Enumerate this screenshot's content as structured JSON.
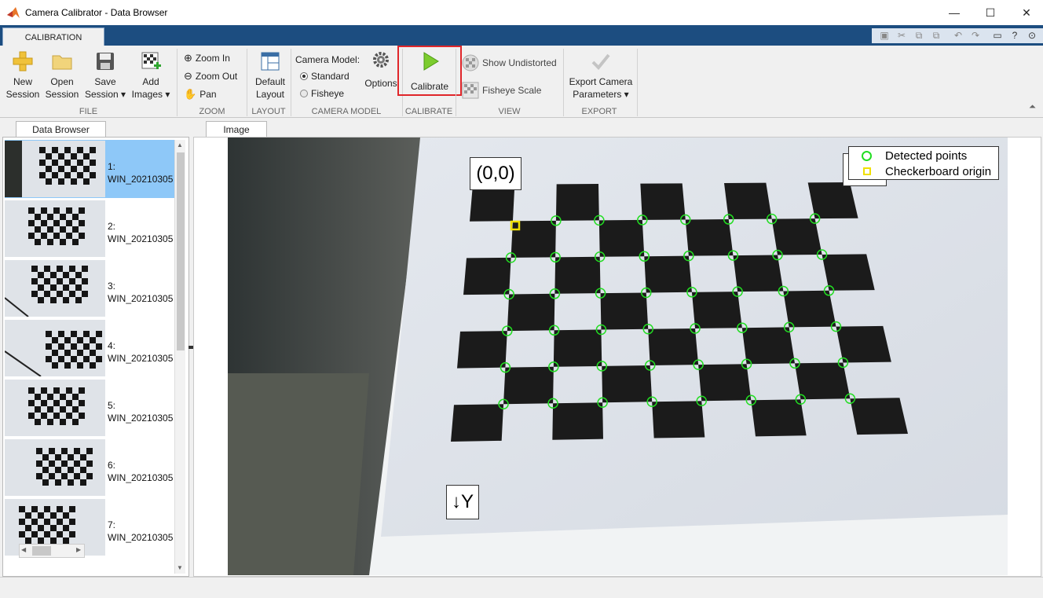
{
  "window": {
    "title": "Camera Calibrator - Data Browser",
    "minimize": "—",
    "maximize": "☐",
    "close": "✕"
  },
  "ribbon": {
    "tab": "CALIBRATION",
    "groups": {
      "file": "FILE",
      "zoom": "ZOOM",
      "layout": "LAYOUT",
      "camera_model": "CAMERA MODEL",
      "calibrate": "CALIBRATE",
      "view": "VIEW",
      "export": "EXPORT"
    },
    "new_session": [
      "New",
      "Session"
    ],
    "open_session": [
      "Open",
      "Session"
    ],
    "save_session": [
      "Save",
      "Session ▾"
    ],
    "add_images": [
      "Add",
      "Images ▾"
    ],
    "zoom_in": "Zoom In",
    "zoom_out": "Zoom Out",
    "pan": "Pan",
    "default_layout": [
      "Default",
      "Layout"
    ],
    "camera_model_label": "Camera Model:",
    "standard": "Standard",
    "fisheye": "Fisheye",
    "options": "Options",
    "calibrate_btn": "Calibrate",
    "show_undistorted": "Show Undistorted",
    "fisheye_scale": "Fisheye Scale",
    "export_camera": [
      "Export Camera",
      "Parameters ▾"
    ],
    "accent_color": "#1c4d80",
    "highlight_color": "#e0262a"
  },
  "data_browser": {
    "tab": "Data Browser",
    "items": [
      {
        "index": "1:",
        "name": "WIN_20210305",
        "selected": true
      },
      {
        "index": "2:",
        "name": "WIN_20210305",
        "selected": false
      },
      {
        "index": "3:",
        "name": "WIN_20210305",
        "selected": false
      },
      {
        "index": "4:",
        "name": "WIN_20210305",
        "selected": false
      },
      {
        "index": "5:",
        "name": "WIN_20210305",
        "selected": false
      },
      {
        "index": "6:",
        "name": "WIN_20210305",
        "selected": false
      },
      {
        "index": "7:",
        "name": "WIN_20210305",
        "selected": false
      }
    ]
  },
  "image_view": {
    "tab": "Image",
    "origin_label": "(0,0)",
    "y_label": "↓Y",
    "legend": {
      "detected": "Detected points",
      "origin": "Checkerboard origin"
    },
    "detected_color": "#22dd22",
    "origin_color": "#f0e000"
  }
}
